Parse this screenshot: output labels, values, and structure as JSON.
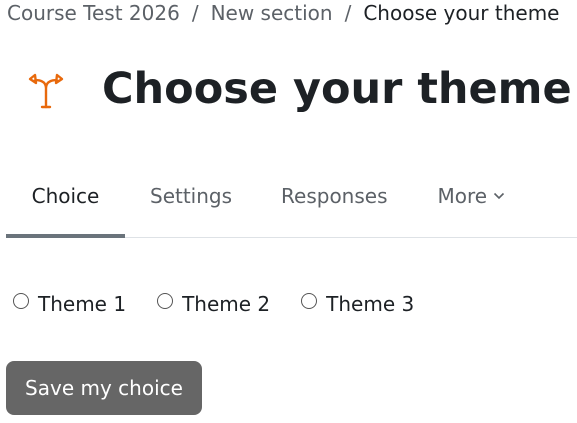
{
  "breadcrumb": {
    "items": [
      "Course Test 2026",
      "New section",
      "Choose your theme"
    ],
    "separator": "/"
  },
  "header": {
    "icon": "choice-fork-icon",
    "icon_color": "#e8690c",
    "title": "Choose your theme"
  },
  "tabs": [
    {
      "label": "Choice",
      "active": true
    },
    {
      "label": "Settings",
      "active": false
    },
    {
      "label": "Responses",
      "active": false
    },
    {
      "label": "More",
      "active": false
    }
  ],
  "options": [
    {
      "label": "Theme 1",
      "checked": false
    },
    {
      "label": "Theme 2",
      "checked": false
    },
    {
      "label": "Theme 3",
      "checked": false
    }
  ],
  "save_button": {
    "label": "Save my choice",
    "color": "#666666"
  }
}
